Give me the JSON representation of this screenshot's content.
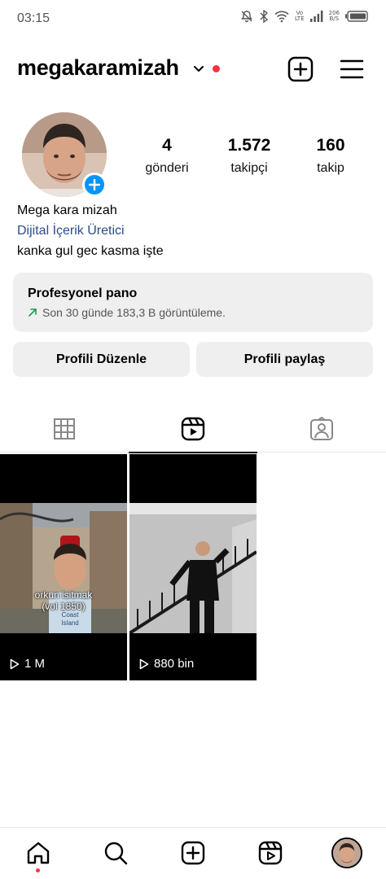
{
  "status_bar": {
    "time": "03:15",
    "network_label_top": "Vo",
    "network_label_bottom": "LTE",
    "speed_top": "206",
    "speed_bottom": "B/S",
    "icons": [
      "mute-icon",
      "bluetooth-icon",
      "wifi-icon",
      "signal-icon",
      "battery-icon"
    ]
  },
  "header": {
    "username": "megakaramizah",
    "icons": [
      "chevron-down-icon",
      "notification-dot",
      "create-icon",
      "menu-icon"
    ]
  },
  "profile": {
    "stats": [
      {
        "value": "4",
        "label": "gönderi"
      },
      {
        "value": "1.572",
        "label": "takipçi"
      },
      {
        "value": "160",
        "label": "takip"
      }
    ],
    "name": "Mega kara mizah",
    "category": "Dijital İçerik Üretici",
    "bio": "kanka gul gec kasma işte"
  },
  "pro_panel": {
    "title": "Profesyonel pano",
    "subtitle": "Son 30 günde 183,3 B görüntüleme."
  },
  "buttons": {
    "edit": "Profili Düzenle",
    "share": "Profili paylaş"
  },
  "tabs": [
    {
      "icon": "grid-icon",
      "active": false
    },
    {
      "icon": "reels-icon",
      "active": true
    },
    {
      "icon": "tagged-icon",
      "active": false
    }
  ],
  "grid": [
    {
      "views": "1 M",
      "caption_line1": "orkun isitmak",
      "caption_line2": "(vol 1850)"
    },
    {
      "views": "880 bin"
    }
  ],
  "bottom_nav": [
    "home-icon",
    "search-icon",
    "create-icon",
    "reels-icon",
    "profile-avatar"
  ],
  "colors": {
    "accent_blue": "#0095f6",
    "notification_red": "#ff3040",
    "category_link": "#2b4c8c",
    "panel_gray": "#efefef",
    "trend_green": "#1a9a50"
  }
}
